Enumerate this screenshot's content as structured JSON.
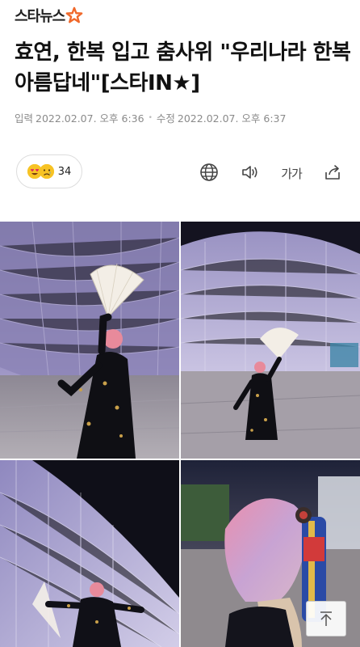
{
  "site": {
    "logo_text": "스타뉴스"
  },
  "article": {
    "headline": "효연, 한복 입고 춤사위 \"우리나라 한복 아름답네\"[스타IN★]",
    "published_label": "입력",
    "published_at": "2022.02.07. 오후 6:36",
    "separator": "•",
    "modified_label": "수정",
    "modified_at": "2022.02.07. 오후 6:37"
  },
  "reactions": {
    "count": "34",
    "icons": [
      "heart-eyes-emoji-icon",
      "sad-emoji-icon"
    ]
  },
  "toolbar": {
    "font_size_label": "가가",
    "icons": [
      "globe-icon",
      "speaker-icon",
      "font-size-icon",
      "share-icon"
    ]
  },
  "gallery": {
    "photos": [
      "hanbok-fan-dance-photo-1",
      "hanbok-fan-dance-photo-2",
      "hanbok-fan-dance-photo-3",
      "hanbok-hair-pin-photo-4"
    ]
  },
  "colors": {
    "accent_orange": "#f0682a",
    "meta_gray": "#8a8a8a",
    "building_purple": "#8c7fb8"
  },
  "scroll_top": {
    "icon": "arrow-up-icon"
  }
}
